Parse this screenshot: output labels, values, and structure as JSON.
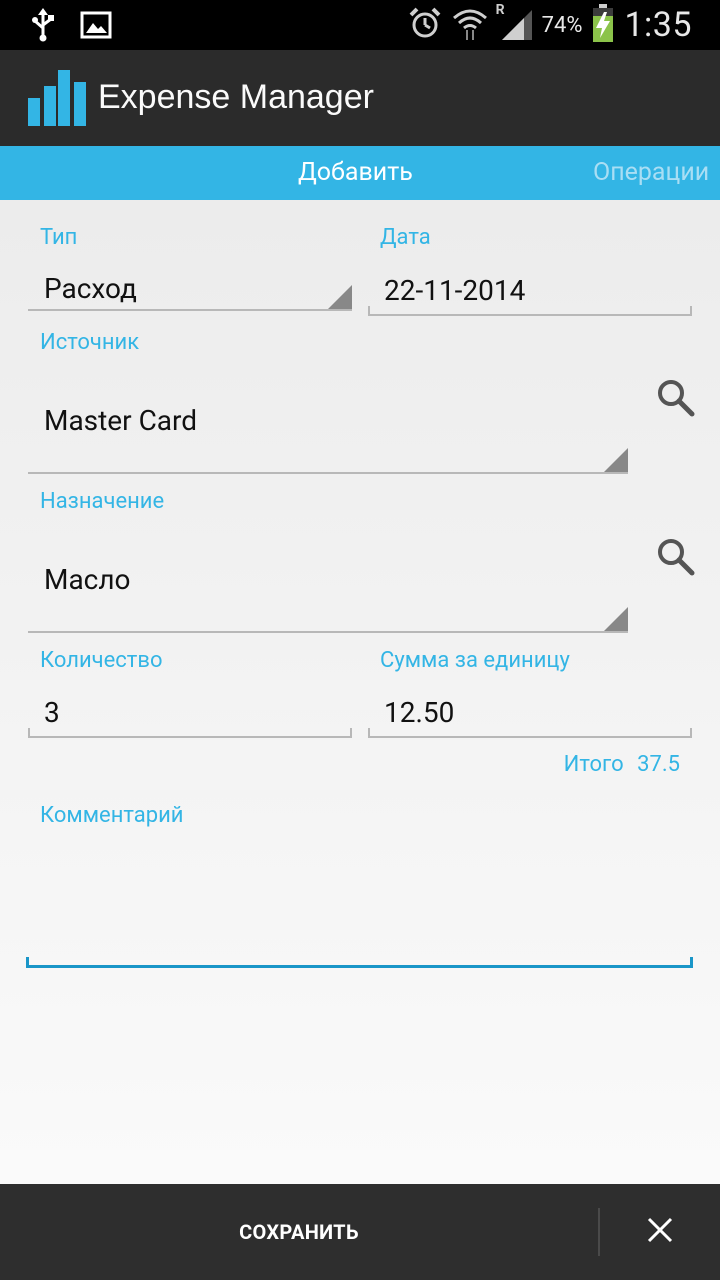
{
  "status_bar": {
    "battery": "74%",
    "time": "1:35",
    "network_roaming": "R"
  },
  "app": {
    "title": "Expense Manager"
  },
  "tabs": [
    {
      "label": "Добавить",
      "active": true
    },
    {
      "label": "Операции",
      "active": false
    }
  ],
  "form": {
    "type": {
      "label": "Тип",
      "value": "Расход"
    },
    "date": {
      "label": "Дата",
      "value": "22-11-2014"
    },
    "source": {
      "label": "Источник",
      "value": "Master Card"
    },
    "purpose": {
      "label": "Назначение",
      "value": "Масло"
    },
    "quantity": {
      "label": "Количество",
      "value": "3"
    },
    "unit_price": {
      "label": "Сумма за единицу",
      "value": "12.50"
    },
    "total": {
      "label": "Итого",
      "value": "37.5"
    },
    "comment": {
      "label": "Комментарий",
      "value": ""
    }
  },
  "bottom_bar": {
    "save_label": "СОХРАНИТЬ"
  },
  "colors": {
    "accent": "#33b5e5",
    "action_bar": "#2b2b2b",
    "bottom_bar": "#2e2e2e"
  }
}
